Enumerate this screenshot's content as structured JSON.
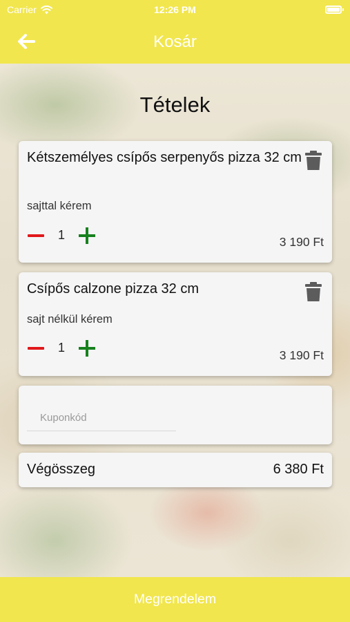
{
  "status_bar": {
    "carrier": "Carrier",
    "time": "12:26 PM"
  },
  "nav": {
    "title": "Kosár",
    "back_icon": "arrow-left-icon"
  },
  "section": {
    "title": "Tételek"
  },
  "items": [
    {
      "name": "Kétszemélyes csípős serpenyős pizza 32 cm",
      "note": "sajttal kérem",
      "quantity": "1",
      "price": "3 190 Ft"
    },
    {
      "name": "Csípős calzone pizza 32 cm",
      "note": "sajt nélkül kérem",
      "quantity": "1",
      "price": "3 190 Ft"
    }
  ],
  "coupon": {
    "placeholder": "Kuponkód",
    "value": ""
  },
  "total": {
    "label": "Végösszeg",
    "value": "6 380 Ft"
  },
  "order_button": {
    "label": "Megrendelem"
  },
  "colors": {
    "accent": "#f1e64d",
    "minus": "#e1181b",
    "plus": "#17811e",
    "card": "#f5f5f5"
  }
}
